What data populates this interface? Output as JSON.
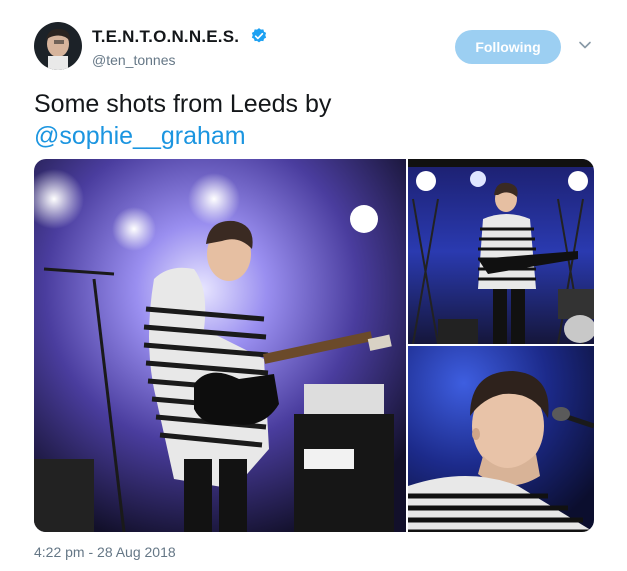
{
  "author": {
    "display_name": "T.E.N.T.O.N.N.E.S.",
    "handle": "@ten_tonnes",
    "avatar_icon": "avatar-photo",
    "verified_icon": "verified-badge-icon"
  },
  "actions": {
    "follow_label": "Following",
    "menu_icon": "chevron-down-icon"
  },
  "tweet": {
    "text": "Some shots from Leeds by",
    "mention": "@sophie__graham"
  },
  "media": {
    "count": 3
  },
  "timestamp": "4:22 pm - 28 Aug 2018",
  "colors": {
    "link": "#1b95e0",
    "follow_button": "#9ccff2",
    "verified": "#1da1f2",
    "secondary_text": "#657786"
  }
}
